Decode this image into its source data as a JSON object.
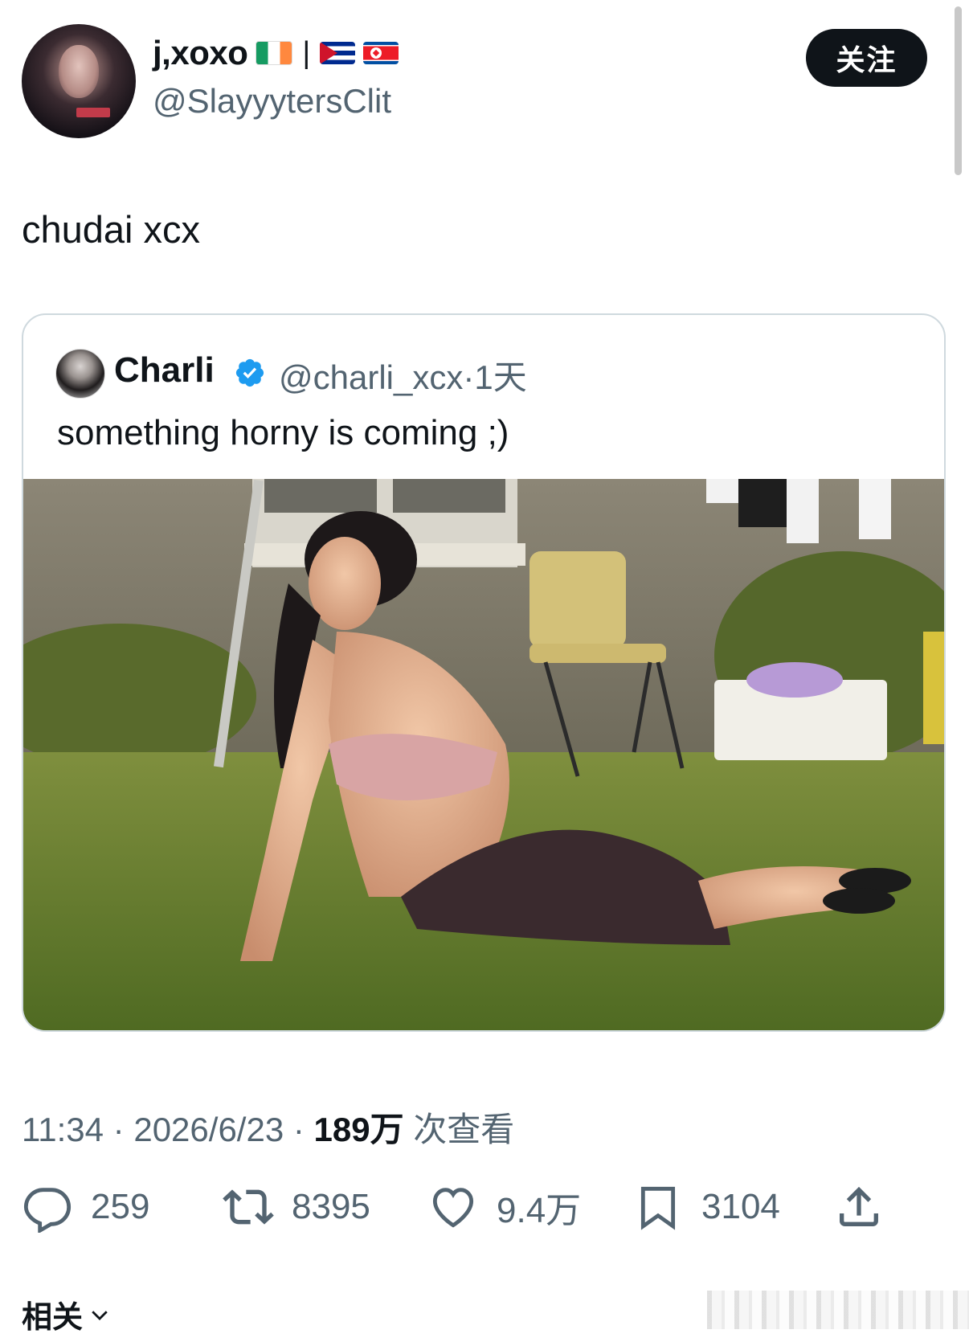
{
  "author": {
    "display_name": "j,xoxo",
    "separator": "|",
    "handle": "@SlayyytersClit",
    "avatar_badge": "DETOUR",
    "flags": [
      "ireland-flag",
      "cuba-flag",
      "north-korea-flag"
    ]
  },
  "follow_button": {
    "label": "关注"
  },
  "tweet": {
    "text": "chudai xcx"
  },
  "quoted": {
    "name": "Charli",
    "verified": true,
    "handle": "@charli_xcx",
    "dot": "·",
    "age": "1天",
    "text": "something horny is coming ;)"
  },
  "meta": {
    "time": "11:34",
    "dot": "·",
    "date": "2026/6/23",
    "views_count": "189万",
    "views_label": "次查看"
  },
  "actions": {
    "replies": "259",
    "reposts": "8395",
    "likes": "9.4万",
    "bookmarks": "3104"
  },
  "related": {
    "label": "相关"
  },
  "colors": {
    "text": "#0f1419",
    "secondary": "#536471",
    "verified": "#1d9bf0",
    "border": "#cfd9de"
  }
}
